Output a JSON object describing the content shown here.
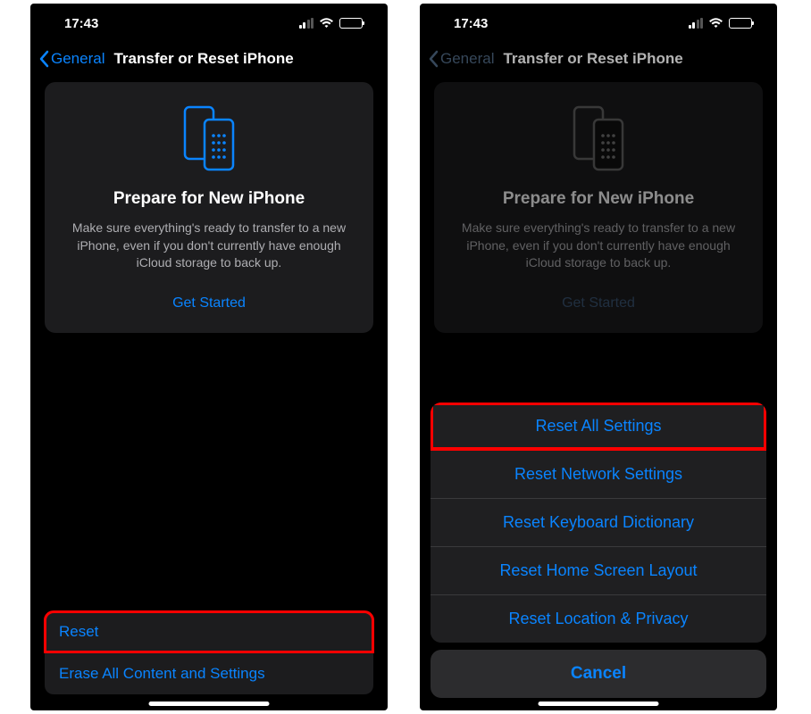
{
  "status": {
    "time": "17:43"
  },
  "nav": {
    "back_label": "General",
    "title": "Transfer or Reset iPhone"
  },
  "prepare_card": {
    "title": "Prepare for New iPhone",
    "description": "Make sure everything's ready to transfer to a new iPhone, even if you don't currently have enough iCloud storage to back up.",
    "cta": "Get Started"
  },
  "options": {
    "reset": "Reset",
    "erase": "Erase All Content and Settings"
  },
  "reset_sheet": {
    "items": [
      "Reset All Settings",
      "Reset Network Settings",
      "Reset Keyboard Dictionary",
      "Reset Home Screen Layout",
      "Reset Location & Privacy"
    ],
    "cancel": "Cancel"
  },
  "colors": {
    "accent": "#0a84ff",
    "highlight": "#ff0000"
  }
}
